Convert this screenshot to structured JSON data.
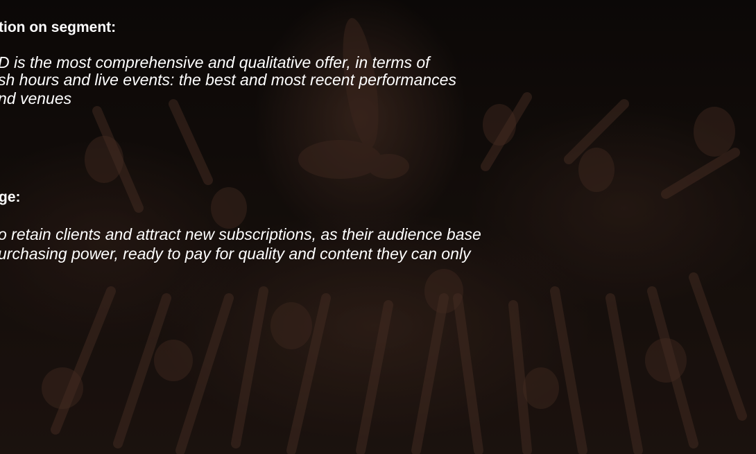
{
  "slide": {
    "section1": {
      "heading": "tion on segment:",
      "lines": [
        "D is the most comprehensive and qualitative offer, in terms of",
        "sh hours and live events: the best and most recent performances",
        "nd venues"
      ]
    },
    "section2": {
      "heading": "ge:",
      "lines": [
        "o retain clients and attract new subscriptions, as their audience base",
        "urchasing power, ready to pay for quality and content they can only"
      ]
    },
    "background_photo": "dance-performance-crowd-reaching-arms",
    "colors": {
      "text": "#ffffff",
      "overlay": "#000000"
    }
  }
}
